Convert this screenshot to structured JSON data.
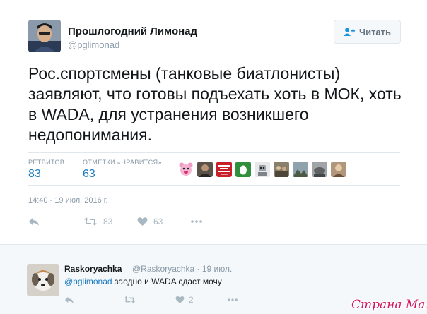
{
  "tweet": {
    "author_name": "Прошлогодний Лимонад",
    "author_handle": "@pglimonad",
    "follow_label": "Читать",
    "text": "Рос.спортсмены (танковые биатлонисты) заявляют, что готовы подъехать хоть в МОК, хоть в WADA, для устранения возникшего недопонимания.",
    "retweets_label": "РЕТВИТОВ",
    "retweets_count": "83",
    "likes_label": "ОТМЕТКИ «НРАВИТСЯ»",
    "likes_count": "63",
    "timestamp": "14:40 - 19 июл. 2016 г.",
    "actions": {
      "retweet_count": "83",
      "like_count": "63"
    },
    "likers": [
      {
        "icon": "pink-bear-avatar-icon",
        "color": "#f19ac5"
      },
      {
        "icon": "user-photo-avatar-icon",
        "color": "#5a5148"
      },
      {
        "icon": "red-text-avatar-icon",
        "color": "#c8202a"
      },
      {
        "icon": "dark-photo-avatar-icon",
        "color": "#3a3d42"
      },
      {
        "icon": "green-egg-avatar-icon",
        "color": "#2f8f3a"
      },
      {
        "icon": "robot-avatar-icon",
        "color": "#b4b8bb"
      },
      {
        "icon": "group-photo-avatar-icon",
        "color": "#6c6455"
      },
      {
        "icon": "landscape-avatar-icon",
        "color": "#4d5a43"
      },
      {
        "icon": "grey-photo-avatar-icon",
        "color": "#7a7d80"
      },
      {
        "icon": "brown-photo-avatar-icon",
        "color": "#8c6d54"
      }
    ]
  },
  "reply": {
    "author_name": "Raskoryachka",
    "meta": "@Raskoryachka · 19 июл.",
    "mention": "@pglimonad",
    "text": " заодно и WADA сдаст мочу",
    "like_count": "2"
  },
  "watermark": "Страна Мам",
  "colors": {
    "link": "#1b7bbf",
    "muted": "#8899a6",
    "watermark": "#d4145a"
  }
}
